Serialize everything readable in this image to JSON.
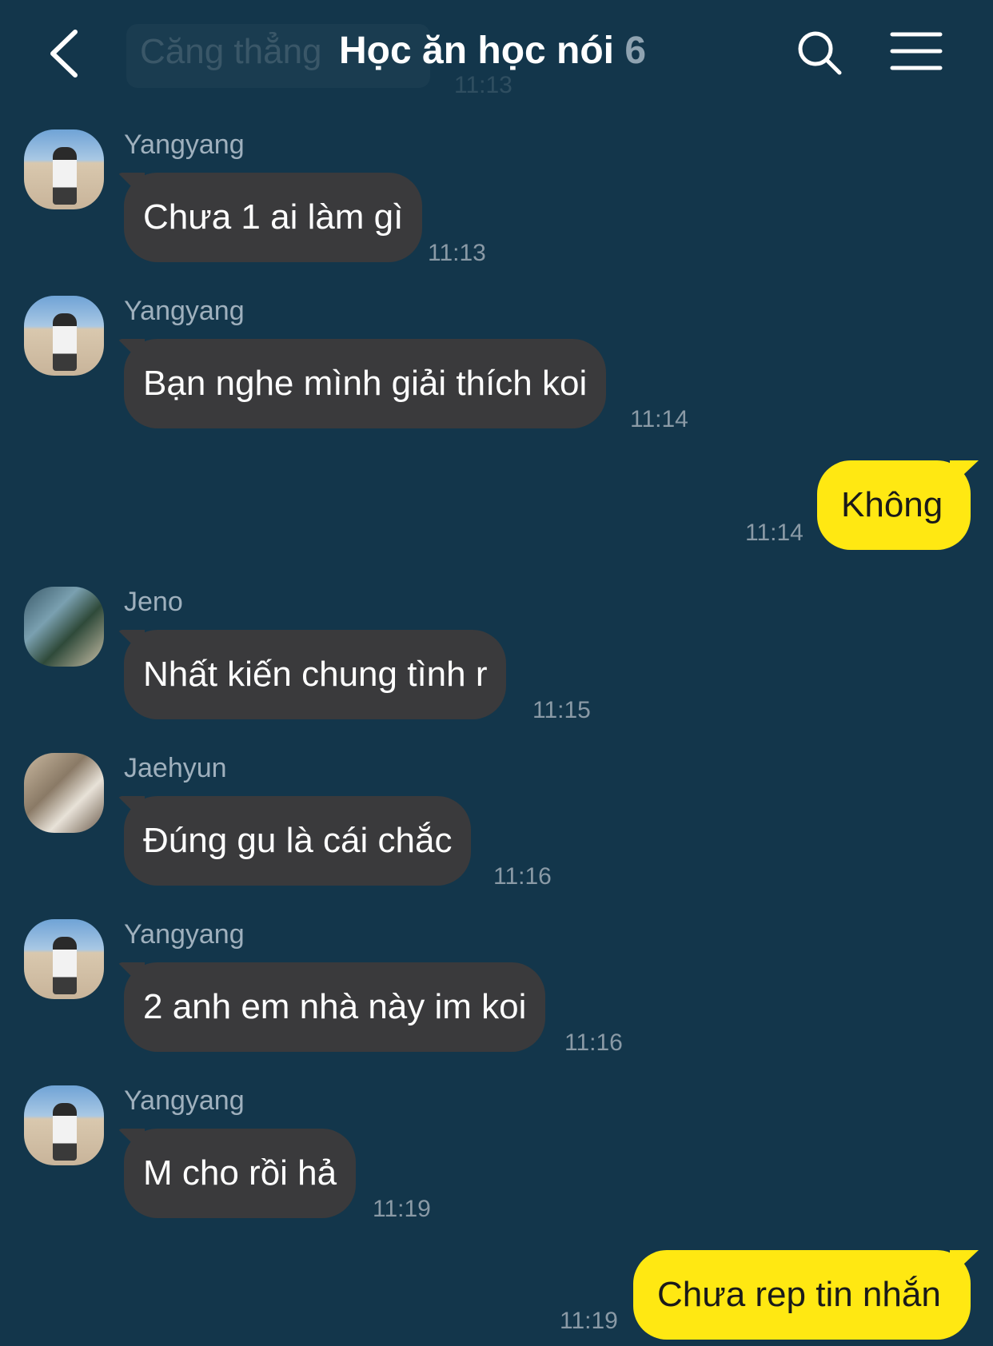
{
  "header": {
    "ghost_text": "Căng thẳng",
    "ghost_time": "11:13",
    "title": "Học ăn học nói",
    "member_count": "6",
    "back_icon": "chevron-left-icon",
    "search_icon": "search-icon",
    "menu_icon": "menu-icon"
  },
  "colors": {
    "background": "#13364b",
    "incoming_bubble": "#3a3a3c",
    "outgoing_bubble": "#ffe812",
    "timestamp": "#8a9aa6",
    "sender_name": "#9fb0bd"
  },
  "messages": [
    {
      "direction": "in",
      "sender": "Yangyang",
      "text": "Chưa 1 ai làm gì",
      "time": "11:13"
    },
    {
      "direction": "in",
      "sender": "Yangyang",
      "text": "Bạn nghe mình giải thích koi",
      "time": "11:14"
    },
    {
      "direction": "out",
      "text": "Không",
      "time": "11:14"
    },
    {
      "direction": "in",
      "sender": "Jeno",
      "text": "Nhất kiến chung tình r",
      "time": "11:15"
    },
    {
      "direction": "in",
      "sender": "Jaehyun",
      "text": "Đúng gu là cái chắc",
      "time": "11:16"
    },
    {
      "direction": "in",
      "sender": "Yangyang",
      "text": "2 anh em nhà này im koi",
      "time": "11:16"
    },
    {
      "direction": "in",
      "sender": "Yangyang",
      "text": "M cho rồi hả",
      "time": "11:19"
    },
    {
      "direction": "out",
      "text": "Chưa rep tin nhắn",
      "time": "11:19"
    }
  ]
}
